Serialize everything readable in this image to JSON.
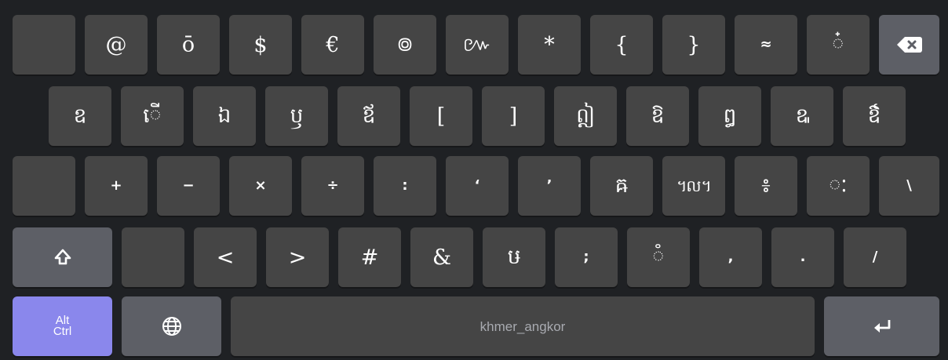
{
  "keyboard": {
    "layout_name": "khmer_angkor",
    "colors": {
      "background": "#1f2124",
      "key": "#454545",
      "function_key": "#5d5f66",
      "alt_ctrl_key": "#8a87ec",
      "label": "#ffffff",
      "space_label": "#a8aab0"
    },
    "row1": [
      "",
      "@",
      "ō",
      "$",
      "€",
      "៙",
      "៚",
      "*",
      "{",
      "}",
      "≈",
      "៎"
    ],
    "row2": [
      "ឧ",
      "ើ",
      "ឯ",
      "ឫ",
      "ឪ",
      "[",
      "]",
      "ឦ",
      "ឱ",
      "ឰ",
      "ឩ",
      "ឳ"
    ],
    "row3": [
      "",
      "+",
      "−",
      "×",
      "÷",
      ":",
      "‘",
      "’",
      "ឝ",
      "៘",
      "៖",
      "ៈ",
      "\\"
    ],
    "row4": [
      "",
      "<",
      ">",
      "#",
      "&",
      "ឞ",
      ";",
      "៓",
      ",",
      ".",
      "/"
    ],
    "bottom": {
      "alt_ctrl_label": "Alt\nCtrl",
      "space_label": "khmer_angkor"
    },
    "icons": {
      "backspace": "backspace-icon",
      "shift": "shift-icon",
      "globe": "globe-icon",
      "enter": "enter-icon"
    }
  }
}
